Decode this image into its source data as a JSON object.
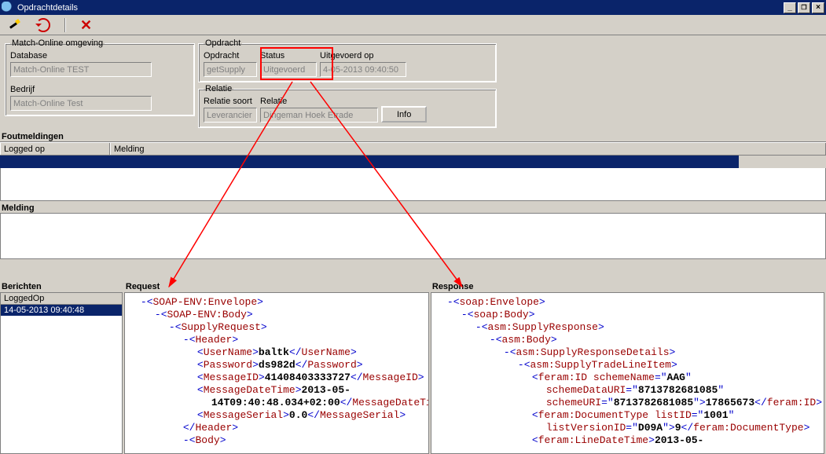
{
  "window": {
    "title": "Opdrachtdetails"
  },
  "toolbar": {},
  "groups": {
    "env": {
      "legend": "Match-Online omgeving",
      "db_label": "Database",
      "db_value": "Match-Online TEST",
      "bedrijf_label": "Bedrijf",
      "bedrijf_value": "Match-Online Test"
    },
    "opdracht": {
      "legend": "Opdracht",
      "opdracht_label": "Opdracht",
      "opdracht_value": "getSupply",
      "status_label": "Status",
      "status_value": "Uitgevoerd",
      "uitgevoerd_label": "Uitgevoerd op",
      "uitgevoerd_value": "4-05-2013 09:40:50"
    },
    "relatie": {
      "legend": "Relatie",
      "soort_label": "Relatie soort",
      "soort_value": "Leverancier",
      "relatie_label": "Relatie",
      "relatie_value": "Dingeman Hoek Etrade",
      "info_btn": "Info"
    }
  },
  "fout": {
    "header": "Foutmeldingen",
    "col1": "Logged op",
    "col2": "Melding"
  },
  "melding": {
    "header": "Melding"
  },
  "berichten": {
    "header": "Berichten",
    "col": "LoggedOp",
    "row": "14-05-2013 09:40:48"
  },
  "request": {
    "header": "Request",
    "l1a": "SOAP-ENV:Envelope",
    "l2a": "SOAP-ENV:Body",
    "l3a": "SupplyRequest",
    "l4a": "Header",
    "user_tag": "UserName",
    "user_val": "baltk",
    "pass_tag": "Password",
    "pass_val": "ds982d",
    "mid_tag": "MessageID",
    "mid_val": "41408403333727",
    "mdt_tag": "MessageDateTime",
    "mdt_val": "2013-05-14T09:40:48.034+02:00",
    "ms_tag": "MessageSerial",
    "ms_val": "0.0",
    "body_tag": "Body"
  },
  "response": {
    "header": "Response",
    "l1": "soap:Envelope",
    "l2": "soap:Body",
    "l3": "asm:SupplyResponse",
    "l4": "asm:Body",
    "l5": "asm:SupplyResponseDetails",
    "l6": "asm:SupplyTradeLineItem",
    "fid_tag": "feram:ID",
    "fid_a1n": "schemeName",
    "fid_a1v": "AAG",
    "fid_a2n": "schemeDataURI",
    "fid_a2v": "8713782681085",
    "fid_a3n": "schemeURI",
    "fid_a3v": "8713782681085",
    "fid_val": "17865673",
    "fdt_tag": "feram:DocumentType",
    "fdt_a1n": "listID",
    "fdt_a1v": "1001",
    "fdt_a2n": "listVersionID",
    "fdt_a2v": "D09A",
    "fdt_val": "9",
    "fldt_tag": "feram:LineDateTime",
    "fldt_val": "2013-05-"
  }
}
